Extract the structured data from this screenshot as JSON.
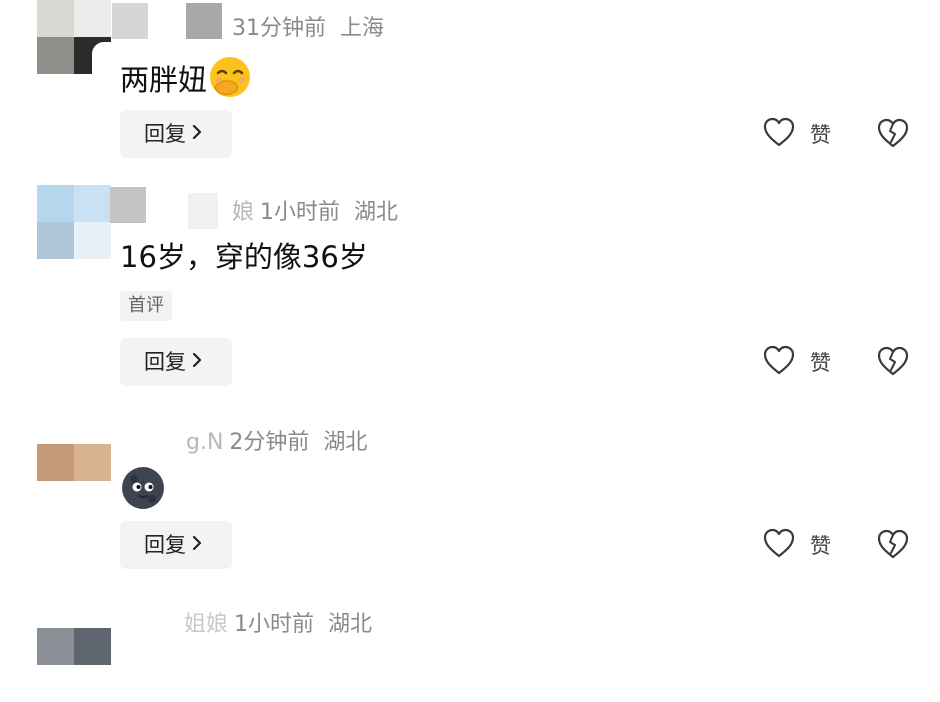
{
  "comments": [
    {
      "time": "31分钟前",
      "location": "上海",
      "text": "两胖妞",
      "emoji": "face-with-hand-over-mouth-emoji",
      "reply_label": "回复",
      "like_label": "赞"
    },
    {
      "name_partial": "娘",
      "time": "1小时前",
      "location": "湖北",
      "text": "16岁，穿的像36岁",
      "badge": "首评",
      "reply_label": "回复",
      "like_label": "赞"
    },
    {
      "name_partial": "g.N",
      "time": "2分钟前",
      "location": "湖北",
      "emoji": "new-moon-face-emoji",
      "reply_label": "回复",
      "like_label": "赞"
    },
    {
      "name_partial": "姐娘",
      "time": "1小时前",
      "location": "湖北"
    }
  ]
}
